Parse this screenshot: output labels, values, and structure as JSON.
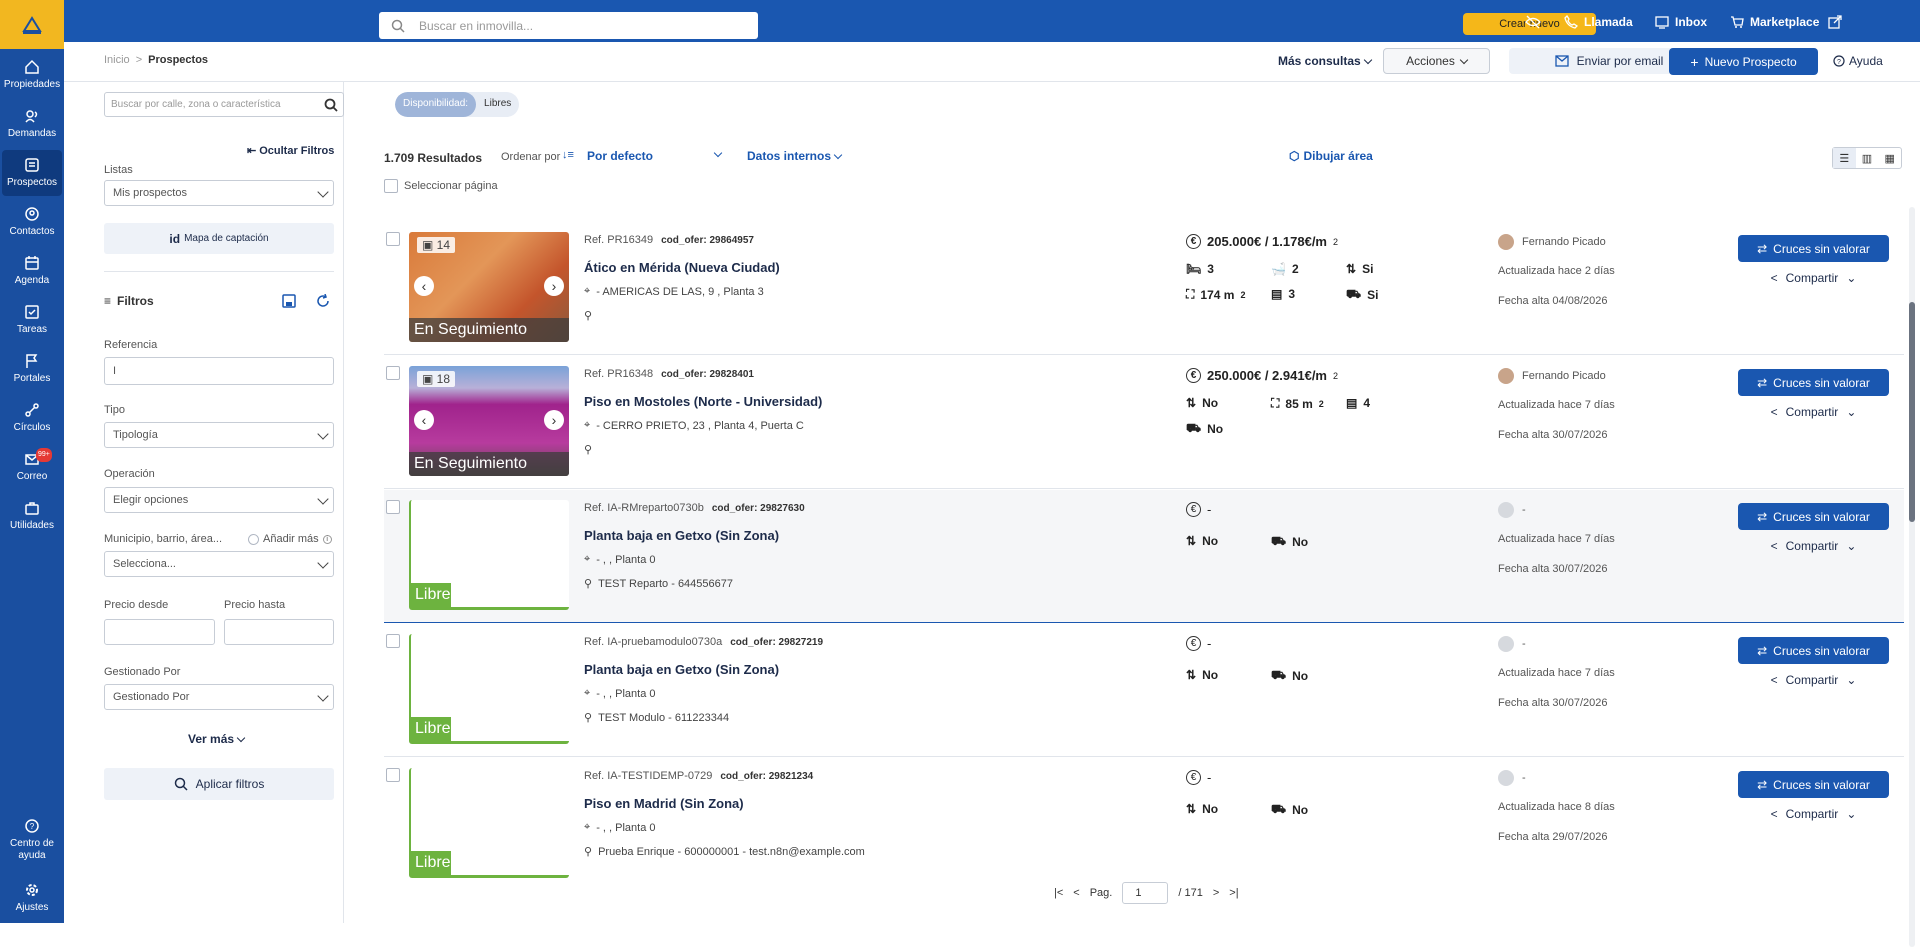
{
  "app": {
    "sidebar": [
      {
        "label": "Propiedades",
        "icon": "home-icon"
      },
      {
        "label": "Demandas",
        "icon": "signal-icon"
      },
      {
        "label": "Prospectos",
        "icon": "list-icon"
      },
      {
        "label": "Contactos",
        "icon": "contact-icon"
      },
      {
        "label": "Agenda",
        "icon": "calendar-icon"
      },
      {
        "label": "Tareas",
        "icon": "tasks-icon"
      },
      {
        "label": "Portales",
        "icon": "flag-icon"
      },
      {
        "label": "Círculos",
        "icon": "circles-icon"
      },
      {
        "label": "Correo",
        "icon": "mail-icon",
        "badge": "99+"
      },
      {
        "label": "Utilidades",
        "icon": "briefcase-icon"
      }
    ],
    "help": "Centro de ayuda",
    "settings": "Ajustes"
  },
  "topbar": {
    "search_placeholder": "Buscar en inmovilla...",
    "crear": "Crear nuevo",
    "llamada": "Llamada",
    "inbox": "Inbox",
    "marketplace": "Marketplace"
  },
  "subbar": {
    "breadcrumb_home": "Inicio",
    "breadcrumb_sep": ">",
    "breadcrumb_current": "Prospectos",
    "mas_consultas": "Más consultas",
    "acciones": "Acciones",
    "enviar": "Enviar por email",
    "nuevo": "Nuevo Prospecto",
    "ayuda": "Ayuda"
  },
  "filters": {
    "search_placeholder": "Buscar por calle, zona o característica",
    "disp_label": "Disponibilidad:",
    "disp_value": "Libres",
    "ocultar": "Ocultar Filtros",
    "listas": "Listas",
    "listas_value": "Mis prospectos",
    "mapa": "Mapa de captación",
    "filtros": "Filtros",
    "referencia": "Referencia",
    "referencia_value": "I",
    "tipo": "Tipo",
    "tipo_value": "Tipología",
    "operacion": "Operación",
    "operacion_value": "Elegir opciones",
    "municipio": "Municipio, barrio, área...",
    "anadir": "Añadir más",
    "municipio_value": "Selecciona...",
    "precio_desde": "Precio desde",
    "precio_hasta": "Precio hasta",
    "gestionado": "Gestionado Por",
    "gestionado_value": "Gestionado Por",
    "ver_mas": "Ver más",
    "aplicar": "Aplicar filtros"
  },
  "results": {
    "count": "1.709 Resultados",
    "ordenar": "Ordenar por",
    "orden_value": "Por defecto",
    "datos": "Datos internos",
    "dibujar": "Dibujar área",
    "seleccionar": "Seleccionar página"
  },
  "rows": [
    {
      "ref": "Ref. PR16349",
      "cod": "cod_ofer: 29864957",
      "title": "Ático en Mérida (Nueva Ciudad)",
      "addr": "- AMERICAS DE LAS, 9 , Planta 3",
      "person": "",
      "price": "205.000€ / 1.178€/m",
      "photos": "14",
      "tag": "En Seguimiento",
      "agent": "Fernando Picado",
      "upd": "Actualizada hace 2 días",
      "alta": "Fecha alta 04/08/2026",
      "f1": "3",
      "f2": "2",
      "f3": "Si",
      "f4": "174 m",
      "f5": "3",
      "f6": "Si",
      "cruces": "Cruces sin valorar",
      "compartir": "Compartir"
    },
    {
      "ref": "Ref. PR16348",
      "cod": "cod_ofer: 29828401",
      "title": "Piso en Mostoles (Norte - Universidad)",
      "addr": "- CERRO PRIETO, 23 , Planta 4, Puerta C",
      "person": "",
      "price": "250.000€ / 2.941€/m",
      "photos": "18",
      "tag": "En Seguimiento",
      "agent": "Fernando Picado",
      "upd": "Actualizada hace 7 días",
      "alta": "Fecha alta 30/07/2026",
      "f1": "No",
      "f2": "85 m",
      "f3": "4",
      "f4": "No",
      "cruces": "Cruces sin valorar",
      "compartir": "Compartir"
    },
    {
      "ref": "Ref. IA-RMreparto0730b",
      "cod": "cod_ofer: 29827630",
      "title": "Planta baja en Getxo (Sin Zona)",
      "addr": "- , , Planta 0",
      "person": "TEST Reparto - 644556677",
      "price": "-",
      "tag": "Libre",
      "agent": "-",
      "upd": "Actualizada hace 7 días",
      "alta": "Fecha alta 30/07/2026",
      "f1": "No",
      "f2": "No",
      "cruces": "Cruces sin valorar",
      "compartir": "Compartir"
    },
    {
      "ref": "Ref. IA-pruebamodulo0730a",
      "cod": "cod_ofer: 29827219",
      "title": "Planta baja en Getxo (Sin Zona)",
      "addr": "- , , Planta 0",
      "person": "TEST Modulo - 611223344",
      "price": "-",
      "tag": "Libre",
      "agent": "-",
      "upd": "Actualizada hace 7 días",
      "alta": "Fecha alta 30/07/2026",
      "f1": "No",
      "f2": "No",
      "cruces": "Cruces sin valorar",
      "compartir": "Compartir"
    },
    {
      "ref": "Ref. IA-TESTIDEMP-0729",
      "cod": "cod_ofer: 29821234",
      "title": "Piso en Madrid (Sin Zona)",
      "addr": "- , , Planta 0",
      "person": "Prueba Enrique - 600000001 - test.n8n@example.com",
      "price": "-",
      "tag": "Libre",
      "agent": "-",
      "upd": "Actualizada hace 8 días",
      "alta": "Fecha alta 29/07/2026",
      "f1": "No",
      "f2": "No",
      "cruces": "Cruces sin valorar",
      "compartir": "Compartir"
    }
  ],
  "pagination": {
    "pag": "Pag.",
    "current": "1",
    "total": "/ 171"
  },
  "colors": {
    "primary": "#1a57b0",
    "sidebar": "#1a4fa0",
    "accent": "#f5b719",
    "libre": "#6db33f"
  }
}
